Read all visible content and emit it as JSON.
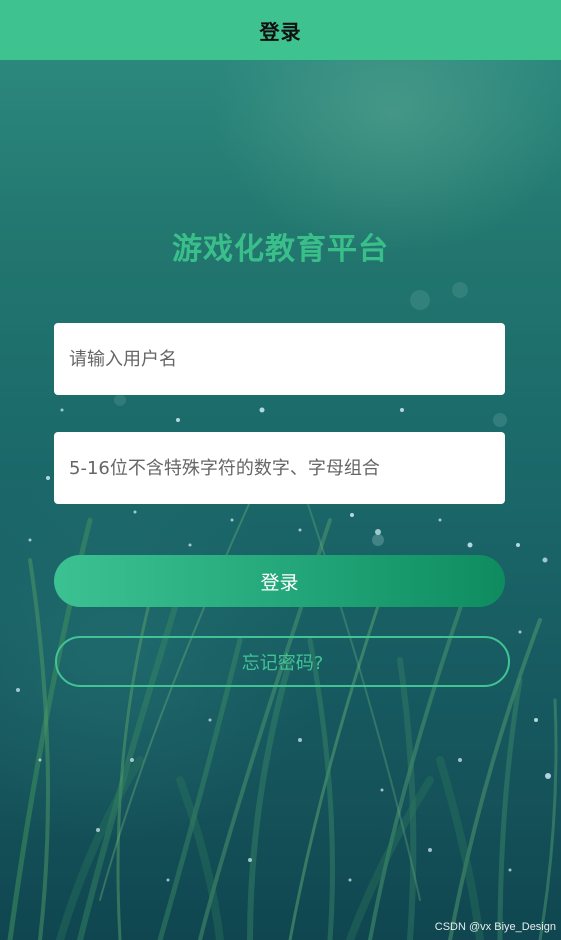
{
  "navbar": {
    "title": "登录"
  },
  "app": {
    "title": "游戏化教育平台"
  },
  "form": {
    "username_placeholder": "请输入用户名",
    "password_placeholder": "5-16位不含特殊字符的数字、字母组合",
    "login_label": "登录",
    "forgot_label": "忘记密码?"
  },
  "watermark": "CSDN @vx Biye_Design",
  "colors": {
    "accent": "#3ec28f",
    "title_green": "#3bbf8a",
    "button_gradient_start": "#3cc292",
    "button_gradient_end": "#0e8c60",
    "background_dark_teal": "#15525a"
  }
}
